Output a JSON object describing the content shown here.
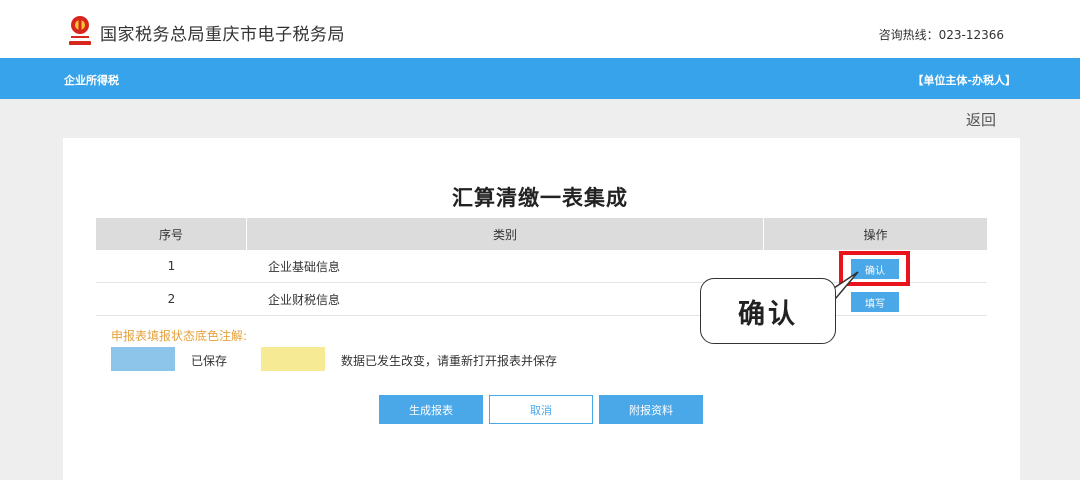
{
  "header": {
    "site_title": "国家税务总局重庆市电子税务局",
    "hotline": "咨询热线：023-12366",
    "emblem_icon": "tax-emblem-icon"
  },
  "nav": {
    "left_label": "企业所得税",
    "right_label": "【单位主体-办税人】"
  },
  "back_label": "返回",
  "form": {
    "title": "汇算清缴一表集成",
    "columns": [
      "序号",
      "类别",
      "操作"
    ],
    "rows": [
      {
        "index": "1",
        "category": "企业基础信息",
        "action": "确认"
      },
      {
        "index": "2",
        "category": "企业财税信息",
        "action": "填写"
      }
    ]
  },
  "callout": {
    "text": "确认"
  },
  "legend": {
    "title": "申报表填报状态底色注解:",
    "saved_label": "已保存",
    "changed_label": "数据已发生改变，请重新打开报表并保存",
    "saved_color": "#8cc4ea",
    "changed_color": "#f6ea94"
  },
  "actions": {
    "generate": "生成报表",
    "cancel": "取消",
    "attach": "附报资料"
  },
  "colors": {
    "brand_blue": "#36a3ea",
    "button_blue": "#4aa8e8",
    "highlight_red": "#e8131c"
  }
}
